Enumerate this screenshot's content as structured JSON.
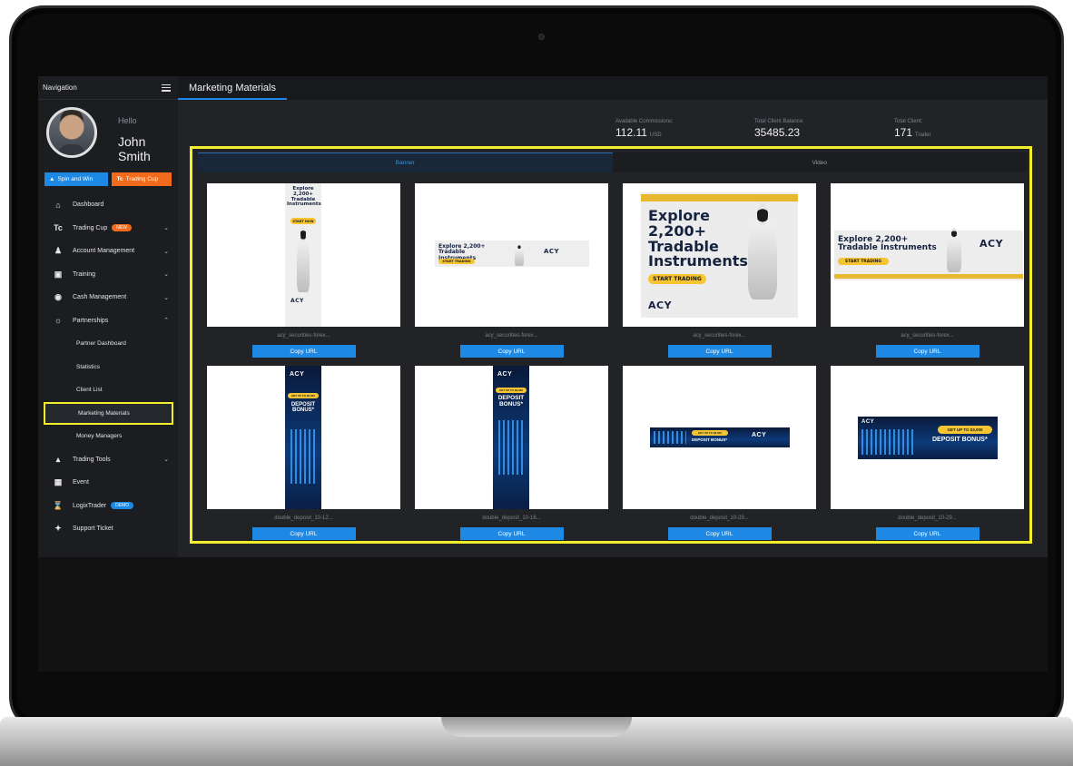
{
  "sidebar": {
    "title": "Navigation",
    "hello": "Hello",
    "user_name": "John Smith",
    "spin_label": "Spin and Win",
    "cup_label": "Trading Cup",
    "cup_prefix": "Tc",
    "items": {
      "dashboard": "Dashboard",
      "trading_cup": "Trading Cup",
      "trading_cup_badge": "NEW",
      "account_management": "Account Management",
      "training": "Training",
      "cash_management": "Cash Management",
      "partnerships": "Partnerships",
      "partner_dashboard": "Partner Dashboard",
      "statistics": "Statistics",
      "client_list": "Client List",
      "marketing_materials": "Marketing Materials",
      "money_managers": "Money Managers",
      "trading_tools": "Trading Tools",
      "event": "Event",
      "logix_trader": "LogixTrader",
      "logix_badge": "DEMO",
      "support_ticket": "Support Ticket"
    }
  },
  "main": {
    "tab": "Marketing Materials",
    "stats": {
      "commissions_label": "Available Commissions:",
      "commissions_value": "112.11",
      "commissions_unit": "USD",
      "balance_label": "Total Client Balance:",
      "balance_value": "35485.23",
      "clients_label": "Total Client:",
      "clients_value": "171",
      "clients_unit": "Trader"
    },
    "media_tabs": {
      "banner": "Banner",
      "video": "Video"
    },
    "copy_label": "Copy URL",
    "cards": [
      {
        "caption": "acy_securities-forex..."
      },
      {
        "caption": "acy_securities-forex..."
      },
      {
        "caption": "acy_securities-forex..."
      },
      {
        "caption": "acy_securities-forex..."
      },
      {
        "caption": "double_deposit_10-12..."
      },
      {
        "caption": "double_deposit_10-16..."
      },
      {
        "caption": "double_deposit_10-29..."
      },
      {
        "caption": "double_deposit_10-29..."
      }
    ]
  },
  "banners": {
    "explore_short": "Explore 2,200+ Tradable Instruments",
    "explore_l1": "Explore",
    "explore_l2": "2,200+",
    "explore_l3": "Tradable",
    "explore_l4": "Instruments",
    "start_trading": "START TRADING",
    "start_now": "START NOW",
    "deposit_bonus": "DEPOSIT BONUS*",
    "deposit_l1": "DEPOSIT",
    "deposit_l2": "BONUS*",
    "get_up_to": "GET UP TO $3,000",
    "acy": "ACY"
  },
  "colors": {
    "accent_blue": "#1e88e5",
    "highlight_yellow": "#f2ee2b",
    "promo_orange": "#f26a1b"
  }
}
